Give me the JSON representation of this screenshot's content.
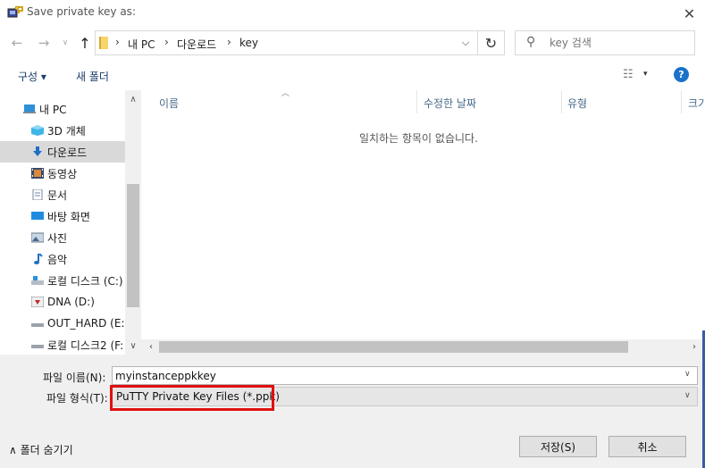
{
  "window": {
    "title": "Save private key as:"
  },
  "address": {
    "crumbs": [
      "내 PC",
      "다운로드",
      "key"
    ],
    "search_placeholder": "key 검색"
  },
  "toolbar": {
    "organize": "구성 ▾",
    "new_folder": "새 폴더"
  },
  "nav": {
    "items": [
      {
        "label": "내 PC",
        "icon": "pc-icon"
      },
      {
        "label": "3D 개체",
        "icon": "3d-objects-icon"
      },
      {
        "label": "다운로드",
        "icon": "download-arrow-icon",
        "selected": true
      },
      {
        "label": "동영상",
        "icon": "video-icon"
      },
      {
        "label": "문서",
        "icon": "document-icon"
      },
      {
        "label": "바탕 화면",
        "icon": "desktop-icon"
      },
      {
        "label": "사진",
        "icon": "pictures-icon"
      },
      {
        "label": "음악",
        "icon": "music-note-icon"
      },
      {
        "label": "로컬 디스크 (C:)",
        "icon": "local-disk-icon"
      },
      {
        "label": "DNA (D:)",
        "icon": "drive-icon"
      },
      {
        "label": "OUT_HARD (E:)",
        "icon": "drive-icon"
      },
      {
        "label": "로컬 디스크2 (F:",
        "icon": "drive-icon"
      }
    ]
  },
  "content": {
    "columns": [
      "이름",
      "수정한 날짜",
      "유형",
      "크기"
    ],
    "empty_message": "일치하는 항목이 없습니다."
  },
  "bottom": {
    "filename_label": "파일 이름(N):",
    "filename_value": "myinstanceppkkey",
    "filetype_label": "파일 형식(T):",
    "filetype_value": "PuTTY Private Key Files (*.ppk)",
    "hide_folders": "폴더 숨기기",
    "save_label": "저장(S)",
    "cancel_label": "취소"
  },
  "colors": {
    "highlight": "#e01010",
    "help": "#1a72c9",
    "selection": "#d9d9d9"
  }
}
